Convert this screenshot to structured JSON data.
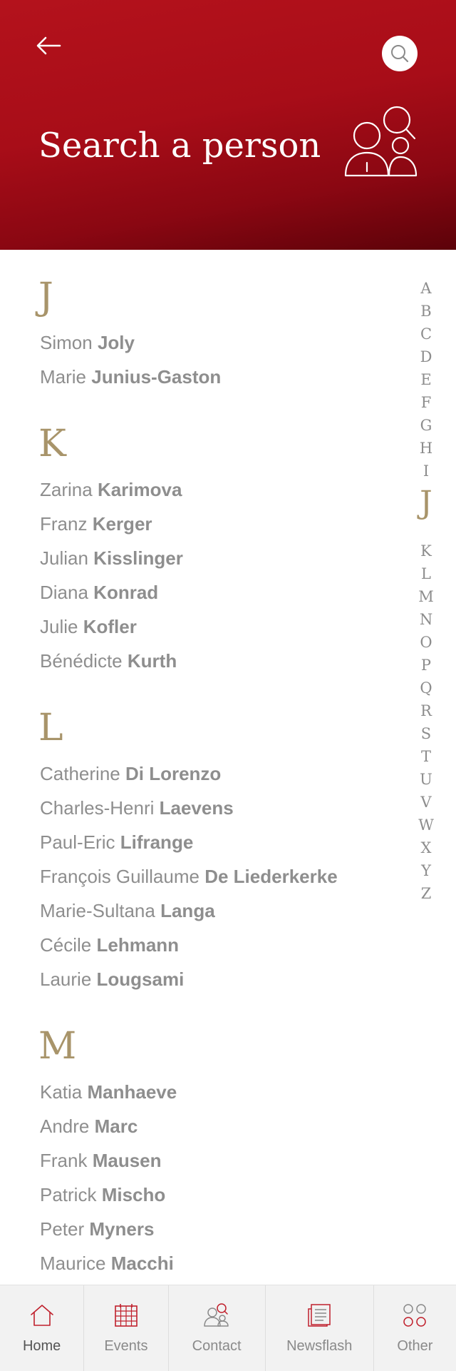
{
  "header": {
    "title": "Search a person"
  },
  "sections": [
    {
      "letter": "J",
      "people": [
        {
          "first": "Simon",
          "last": "Joly"
        },
        {
          "first": "Marie",
          "last": "Junius-Gaston"
        }
      ]
    },
    {
      "letter": "K",
      "people": [
        {
          "first": "Zarina",
          "last": "Karimova"
        },
        {
          "first": "Franz",
          "last": "Kerger"
        },
        {
          "first": "Julian",
          "last": "Kisslinger"
        },
        {
          "first": "Diana",
          "last": "Konrad"
        },
        {
          "first": "Julie",
          "last": "Kofler"
        },
        {
          "first": "Bénédicte",
          "last": "Kurth"
        }
      ]
    },
    {
      "letter": "L",
      "people": [
        {
          "first": "Catherine",
          "last": "Di Lorenzo"
        },
        {
          "first": "Charles-Henri",
          "last": "Laevens"
        },
        {
          "first": "Paul-Eric",
          "last": "Lifrange"
        },
        {
          "first": "François Guillaume",
          "last": "De Liederkerke"
        },
        {
          "first": "Marie-Sultana",
          "last": "Langa"
        },
        {
          "first": "Cécile",
          "last": "Lehmann"
        },
        {
          "first": "Laurie",
          "last": "Lougsami"
        }
      ]
    },
    {
      "letter": "M",
      "people": [
        {
          "first": "Katia",
          "last": "Manhaeve"
        },
        {
          "first": "Andre",
          "last": "Marc"
        },
        {
          "first": "Frank",
          "last": "Mausen"
        },
        {
          "first": "Patrick",
          "last": "Mischo"
        },
        {
          "first": "Peter",
          "last": "Myners"
        },
        {
          "first": "Maurice",
          "last": "Macchi"
        }
      ]
    }
  ],
  "alphabet": {
    "letters": [
      "A",
      "B",
      "C",
      "D",
      "E",
      "F",
      "G",
      "H",
      "I",
      "J",
      "K",
      "L",
      "M",
      "N",
      "O",
      "P",
      "Q",
      "R",
      "S",
      "T",
      "U",
      "V",
      "W",
      "X",
      "Y",
      "Z"
    ],
    "active": "J"
  },
  "tabbar": {
    "items": [
      {
        "label": "Home",
        "icon": "home-icon",
        "active": true
      },
      {
        "label": "Events",
        "icon": "calendar-icon",
        "active": false
      },
      {
        "label": "Contact",
        "icon": "contact-icon",
        "active": false
      },
      {
        "label": "Newsflash",
        "icon": "newsflash-icon",
        "active": false
      },
      {
        "label": "Other",
        "icon": "grid-icon",
        "active": false
      }
    ]
  },
  "colors": {
    "header_red": "#b4121c",
    "header_dark": "#5c0209",
    "letter_gold": "#a8946a",
    "text_gray": "#8e8e8e",
    "accent_red": "#c0202c"
  }
}
